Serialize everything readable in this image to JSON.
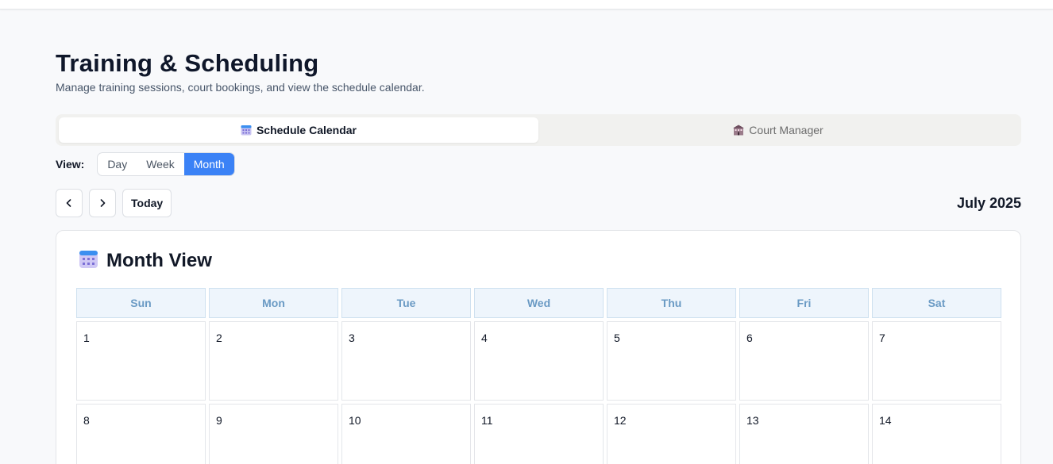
{
  "header": {
    "title": "Training & Scheduling",
    "subtitle": "Manage training sessions, court bookings, and view the schedule calendar."
  },
  "tabs": [
    {
      "label": "Schedule Calendar",
      "icon": "calendar-icon",
      "active": true
    },
    {
      "label": "Court Manager",
      "icon": "building-icon",
      "active": false
    }
  ],
  "view": {
    "label": "View:",
    "options": [
      "Day",
      "Week",
      "Month"
    ],
    "selected": "Month"
  },
  "nav": {
    "prev_icon": "chevron-left-icon",
    "next_icon": "chevron-right-icon",
    "today_label": "Today",
    "current_month": "July 2025"
  },
  "calendar": {
    "title": "Month View",
    "title_icon": "calendar-icon",
    "weekdays": [
      "Sun",
      "Mon",
      "Tue",
      "Wed",
      "Thu",
      "Fri",
      "Sat"
    ],
    "weeks": [
      [
        "1",
        "2",
        "3",
        "4",
        "5",
        "6",
        "7"
      ],
      [
        "8",
        "9",
        "10",
        "11",
        "12",
        "13",
        "14"
      ]
    ]
  },
  "colors": {
    "accent": "#3b82f6",
    "weekday_header_bg": "#eef5fc",
    "weekday_header_text": "#6a9ac4"
  }
}
